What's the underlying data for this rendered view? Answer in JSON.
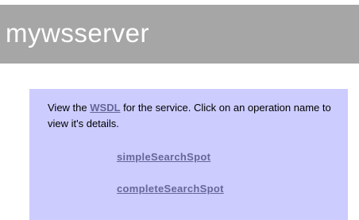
{
  "header": {
    "title": "mywsserver"
  },
  "intro": {
    "before_link": "View the ",
    "link_label": "WSDL",
    "after_link": " for the service. Click on an operation name to view it's details."
  },
  "operations": [
    {
      "label": "simpleSearchSpot"
    },
    {
      "label": "completeSearchSpot"
    }
  ],
  "colors": {
    "header_bg": "#a6a6a6",
    "header_text": "#ffffff",
    "panel_bg": "#ccccff",
    "link": "#666699"
  }
}
